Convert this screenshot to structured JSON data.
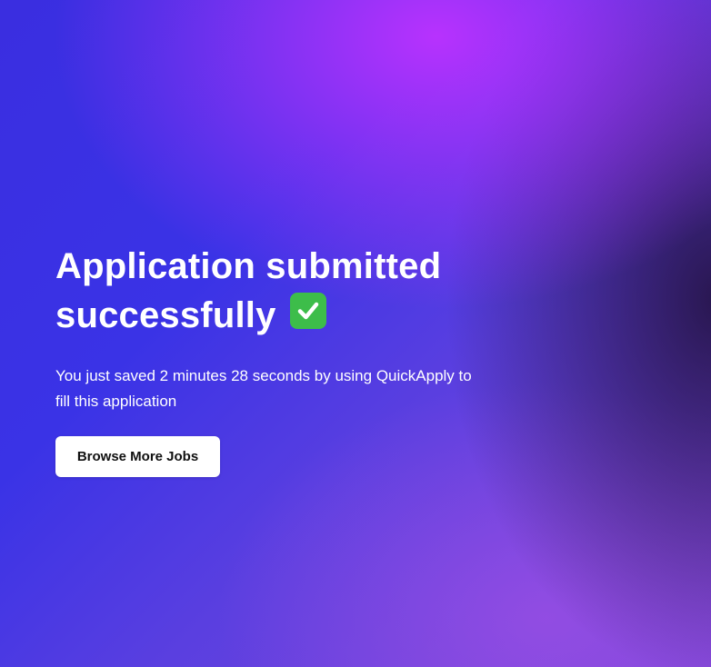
{
  "confirmation": {
    "title_line1": "Application submitted",
    "title_line2": "successfully",
    "status_icon": "check-mark-button-icon",
    "message": "You just saved 2 minutes 28 seconds by using QuickApply to fill this application",
    "browse_button_label": "Browse More Jobs"
  },
  "colors": {
    "background_gradient": [
      "#3a2ee0",
      "#be32ff",
      "#7d47d8"
    ],
    "check_icon_bg": "#3dbd4a",
    "button_bg": "#ffffff",
    "text": "#ffffff"
  }
}
